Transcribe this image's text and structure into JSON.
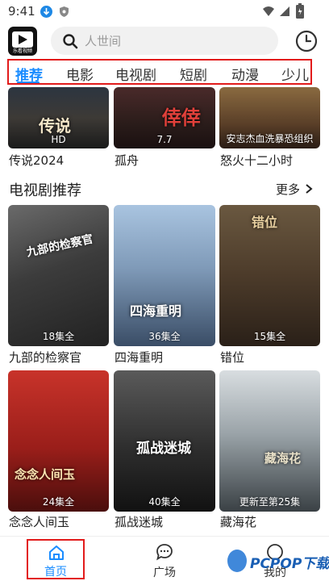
{
  "status_bar": {
    "time": "9:41"
  },
  "header": {
    "logo_text": "乐看视频",
    "search": {
      "placeholder": "人世间"
    }
  },
  "tabs": [
    {
      "label": "推荐",
      "active": true
    },
    {
      "label": "电影"
    },
    {
      "label": "电视剧"
    },
    {
      "label": "短剧"
    },
    {
      "label": "动漫"
    },
    {
      "label": "少儿"
    }
  ],
  "top_row": [
    {
      "title": "传说2024",
      "poster_text": "传说",
      "badge": "HD"
    },
    {
      "title": "孤舟",
      "poster_text": "倖倖",
      "badge": "7.7"
    },
    {
      "title": "怒火十二小时",
      "poster_text": "",
      "badge": "安志杰血洗暴恐组织"
    }
  ],
  "tv_section": {
    "title": "电视剧推荐",
    "more_label": "更多",
    "items": [
      {
        "title": "九部的检察官",
        "badge": "18集全",
        "poster_text": "九部的检察官"
      },
      {
        "title": "四海重明",
        "badge": "36集全",
        "poster_text": "四海重明"
      },
      {
        "title": "错位",
        "badge": "15集全",
        "poster_text": "错位"
      },
      {
        "title": "念念人间玉",
        "badge": "24集全",
        "poster_text": "念念人间玉"
      },
      {
        "title": "孤战迷城",
        "badge": "40集全",
        "poster_text": "孤战迷城"
      },
      {
        "title": "藏海花",
        "badge": "更新至第25集",
        "poster_text": "藏海花"
      }
    ]
  },
  "bottom_nav": [
    {
      "label": "首页",
      "active": true
    },
    {
      "label": "广场"
    },
    {
      "label": "我的"
    }
  ],
  "watermark": "PCPOP下载",
  "colors": {
    "accent": "#1a8cff",
    "highlight_border": "#e21b1b"
  }
}
